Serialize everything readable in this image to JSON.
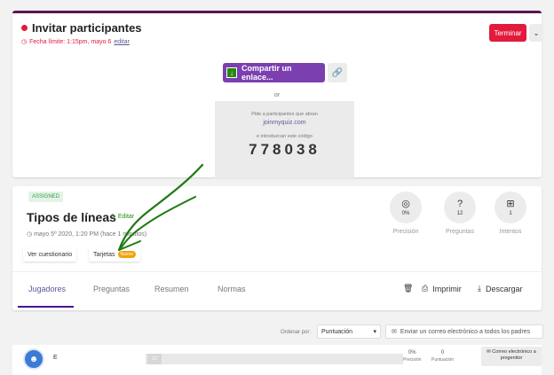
{
  "invite": {
    "title": "Invitar participantes",
    "deadline_text": "Fecha límite: 1:15pm, mayo 6",
    "deadline_edit": "editar",
    "end_button": "Terminar",
    "share_button": "Compartir un enlace...",
    "or_text": "or",
    "join_instructions": "Pide a participantes que abran",
    "join_url": "joinmyquiz.com",
    "code_instructions": "e introduzcan este código",
    "game_code": "778038"
  },
  "report": {
    "badge": "ASSIGNED",
    "title": "Tipos de líneas",
    "edit_label": "Editar",
    "date": "mayo 5º 2020, 1:20 PM (hace 1 minutos)",
    "view_quiz_button": "Ver cuestionario",
    "flashcards_button": "Tarjetas",
    "new_tag": "Nuevo",
    "stats": [
      {
        "icon": "target-icon",
        "value": "0%",
        "label": "Precisión"
      },
      {
        "icon": "question-icon",
        "value": "12",
        "label": "Preguntas"
      },
      {
        "icon": "attempts-icon",
        "value": "1",
        "label": "Intentos"
      }
    ]
  },
  "tabs": [
    "Jugadores",
    "Preguntas",
    "Resumen",
    "Normas"
  ],
  "active_tab": "Jugadores",
  "toolbar": {
    "print": "Imprimir",
    "download": "Descargar"
  },
  "sort": {
    "label": "Ordenar por:",
    "value": "Puntuación"
  },
  "email_all_parents": "Enviar un correo electrónico a todos los padres",
  "players": [
    {
      "name": "E",
      "progress": "12",
      "accuracy": "0%",
      "accuracy_label": "Precisión",
      "score": "0",
      "score_label": "Puntuación",
      "parent_email_button": "Correo electrónico a progenitor"
    }
  ],
  "colors": {
    "accent": "#46178f",
    "end_red": "#e21b3c",
    "share_purple": "#7b3fb0",
    "edit_green": "#26890c",
    "annotation_green": "#1f7a12"
  }
}
